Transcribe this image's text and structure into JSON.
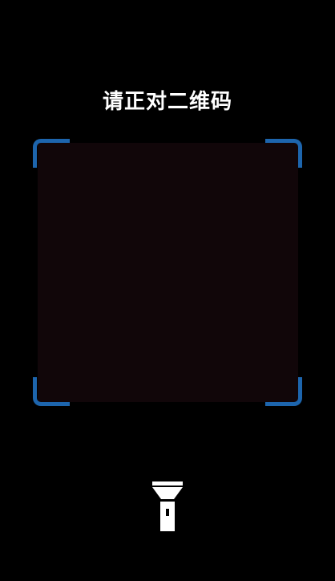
{
  "scanner": {
    "title": "请正对二维码",
    "frame_color": "#1d65ad",
    "scan_area_color": "#110609"
  },
  "controls": {
    "flashlight_icon": "flashlight-icon",
    "flashlight_color": "#ffffff"
  }
}
